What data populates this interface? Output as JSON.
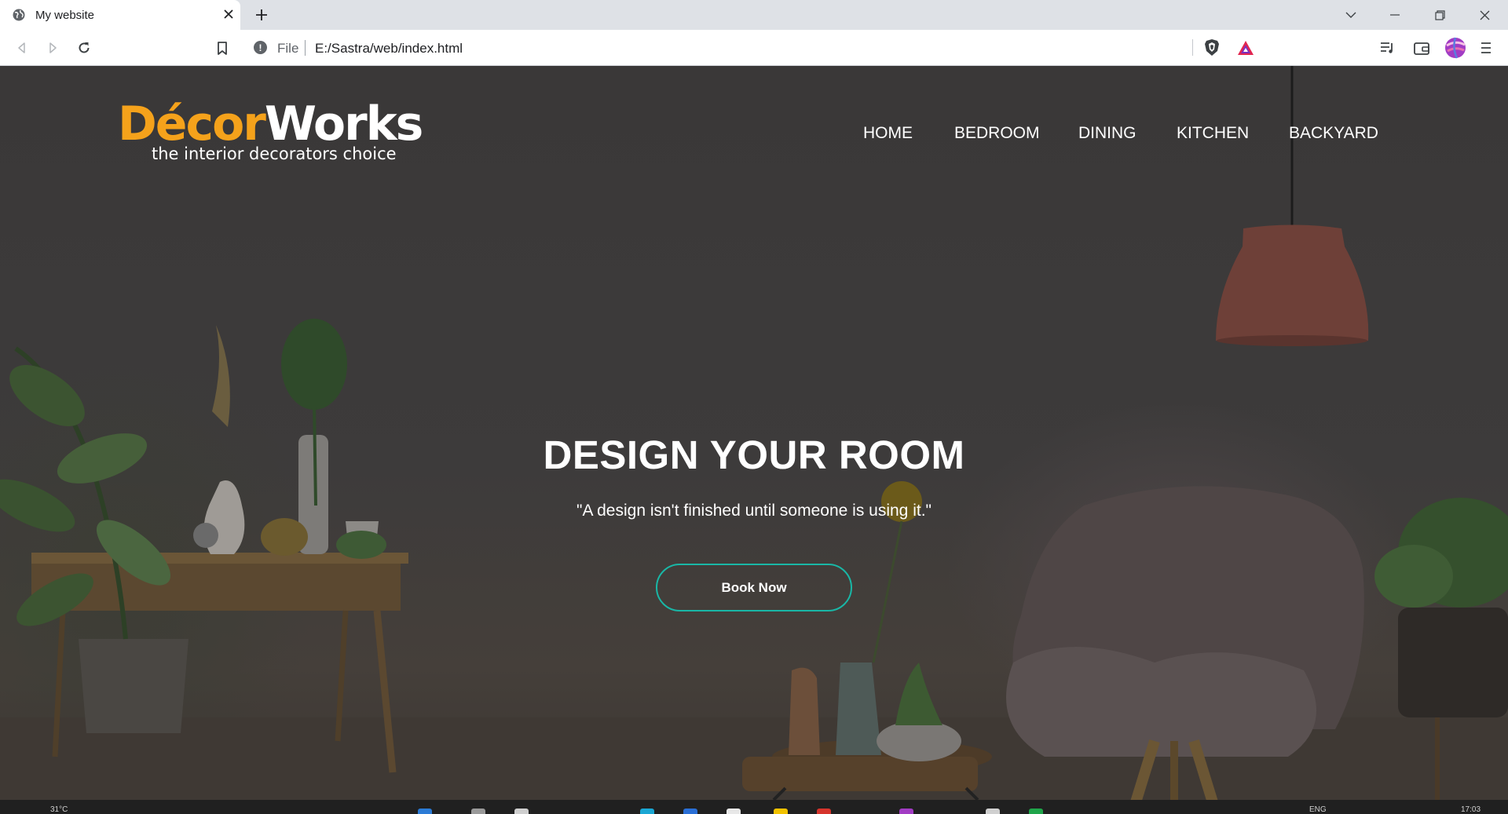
{
  "browser": {
    "tab": {
      "title": "My website",
      "favicon": "globe-icon",
      "close_icon": "close-icon"
    },
    "new_tab_icon": "plus-icon",
    "window_controls": [
      "chevron-down-icon",
      "minimize-icon",
      "restore-icon",
      "close-icon"
    ],
    "toolbar": {
      "nav_icons": [
        "back-arrow-icon",
        "forward-arrow-icon",
        "reload-icon"
      ],
      "bookmark_icon": "bookmark-icon",
      "address": {
        "scheme_label": "File",
        "url": "E:/Sastra/web/index.html",
        "info_icon": "info-icon"
      },
      "extension_icons": [
        "brave-shield-icon",
        "brave-rewards-icon"
      ],
      "right_icons": [
        "playlist-icon",
        "wallet-icon",
        "profile-avatar",
        "menu-icon"
      ]
    }
  },
  "site": {
    "logo": {
      "part1": "Décor",
      "part2": "Works",
      "tagline": "the interior decorators choice",
      "color_primary": "#f5a21b",
      "color_secondary": "#ffffff"
    },
    "nav": [
      "HOME",
      "BEDROOM",
      "DINING",
      "KITCHEN",
      "BACKYARD"
    ],
    "hero": {
      "title": "DESIGN YOUR ROOM",
      "quote": "\"A design isn't finished until someone is using it.\"",
      "button": "Book Now",
      "button_border_color": "#19b7a6"
    }
  },
  "taskbar": {
    "weather": "31°C",
    "language": "ENG",
    "time": "17:03"
  }
}
